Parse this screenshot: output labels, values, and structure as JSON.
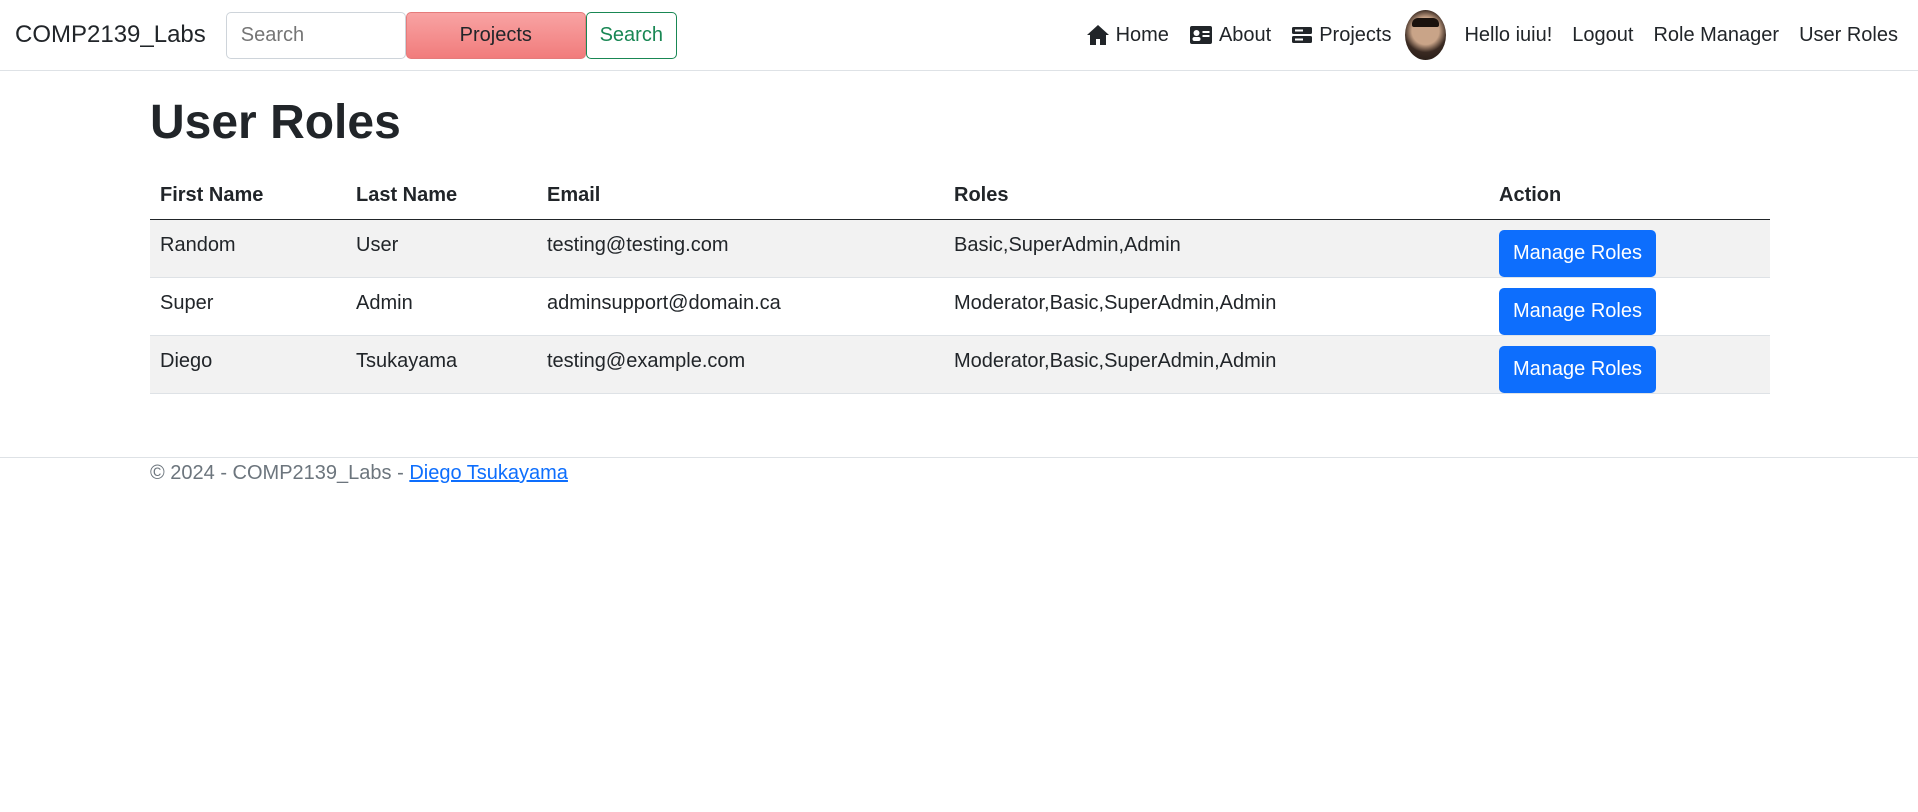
{
  "navbar": {
    "brand": "COMP2139_Labs",
    "search_placeholder": "Search",
    "projects_dropdown": "Projects",
    "search_button": "Search",
    "links": {
      "home": "Home",
      "about": "About",
      "projects": "Projects",
      "greeting": "Hello iuiu!",
      "logout": "Logout",
      "role_manager": "Role Manager",
      "user_roles": "User Roles"
    }
  },
  "main": {
    "title": "User Roles",
    "table": {
      "headers": [
        "First Name",
        "Last Name",
        "Email",
        "Roles",
        "Action"
      ],
      "rows": [
        {
          "first": "Random",
          "last": "User",
          "email": "testing@testing.com",
          "roles": "Basic,SuperAdmin,Admin",
          "action": "Manage Roles"
        },
        {
          "first": "Super",
          "last": "Admin",
          "email": "adminsupport@domain.ca",
          "roles": "Moderator,Basic,SuperAdmin,Admin",
          "action": "Manage Roles"
        },
        {
          "first": "Diego",
          "last": "Tsukayama",
          "email": "testing@example.com",
          "roles": "Moderator,Basic,SuperAdmin,Admin",
          "action": "Manage Roles"
        }
      ]
    }
  },
  "footer": {
    "text": "© 2024 - COMP2139_Labs - ",
    "link": "Diego Tsukayama"
  },
  "colors": {
    "primary": "#0d6efd",
    "success": "#198754",
    "projects_dropdown_bg": "#f17c7c",
    "striped_row": "#f2f2f2"
  },
  "icons": {
    "home": "house-icon",
    "about": "id-card-icon",
    "projects": "server-icon",
    "avatar": "user-avatar"
  }
}
